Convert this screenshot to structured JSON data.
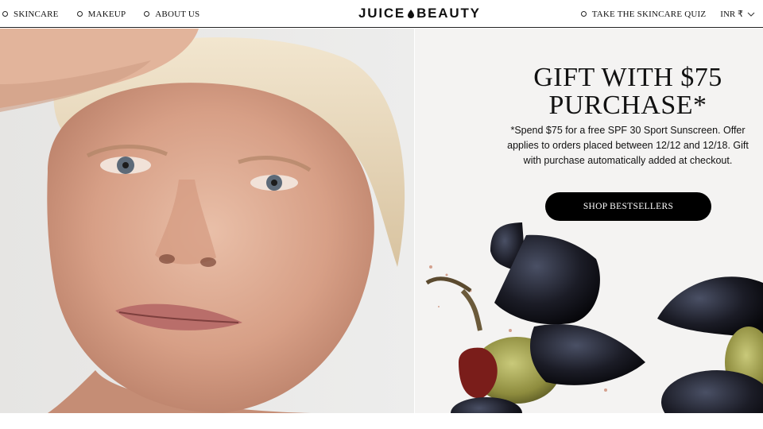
{
  "header": {
    "nav_left": [
      {
        "label": "SKINCARE"
      },
      {
        "label": "MAKEUP"
      },
      {
        "label": "ABOUT US"
      }
    ],
    "logo_left": "JUICE",
    "logo_right": "BEAUTY",
    "quiz_label": "TAKE THE SKINCARE QUIZ",
    "currency_label": "INR ₹",
    "icons": {
      "nav_bullet": "circle-outline-icon",
      "logo_mark": "drop-icon",
      "currency_toggle": "chevron-down-icon"
    }
  },
  "hero": {
    "title_line1": "GIFT WITH $75",
    "title_line2": "PURCHASE*",
    "body": "*Spend $75 for a free SPF 30 Sport Sunscreen. Offer applies to orders placed between 12/12 and 12/18. Gift with purchase automatically added at checkout.",
    "cta_label": "SHOP BESTSELLERS",
    "colors": {
      "button_bg": "#000000",
      "button_text": "#ffffff",
      "panel_bg": "#f4f3f2"
    }
  }
}
